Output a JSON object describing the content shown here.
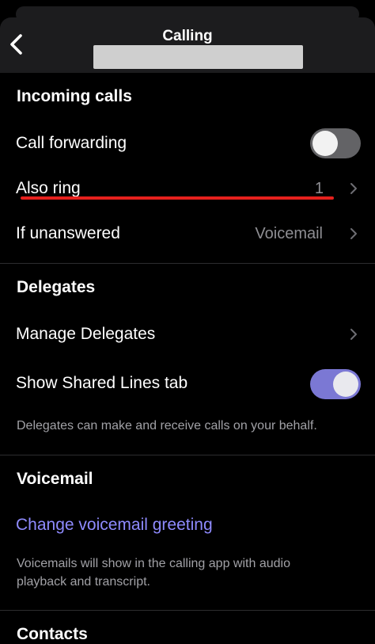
{
  "header": {
    "title": "Calling"
  },
  "incoming_calls": {
    "section_title": "Incoming calls",
    "call_forwarding": {
      "label": "Call forwarding",
      "enabled": false
    },
    "also_ring": {
      "label": "Also ring",
      "value": "1"
    },
    "if_unanswered": {
      "label": "If unanswered",
      "value": "Voicemail"
    }
  },
  "delegates": {
    "section_title": "Delegates",
    "manage": {
      "label": "Manage Delegates"
    },
    "shared_lines": {
      "label": "Show Shared Lines tab",
      "enabled": true
    },
    "note": "Delegates can make and receive calls on your behalf."
  },
  "voicemail": {
    "section_title": "Voicemail",
    "change_greeting": "Change voicemail greeting",
    "note_line1": "Voicemails will show in the calling app with audio",
    "note_line2": "playback and transcript."
  },
  "contacts": {
    "section_title": "Contacts"
  },
  "colors": {
    "accent": "#7b78d4",
    "link": "#8f8bff",
    "annotation": "#e5201d"
  },
  "icons": {
    "back": "chevron-left-icon",
    "disclosure": "chevron-right-icon"
  }
}
